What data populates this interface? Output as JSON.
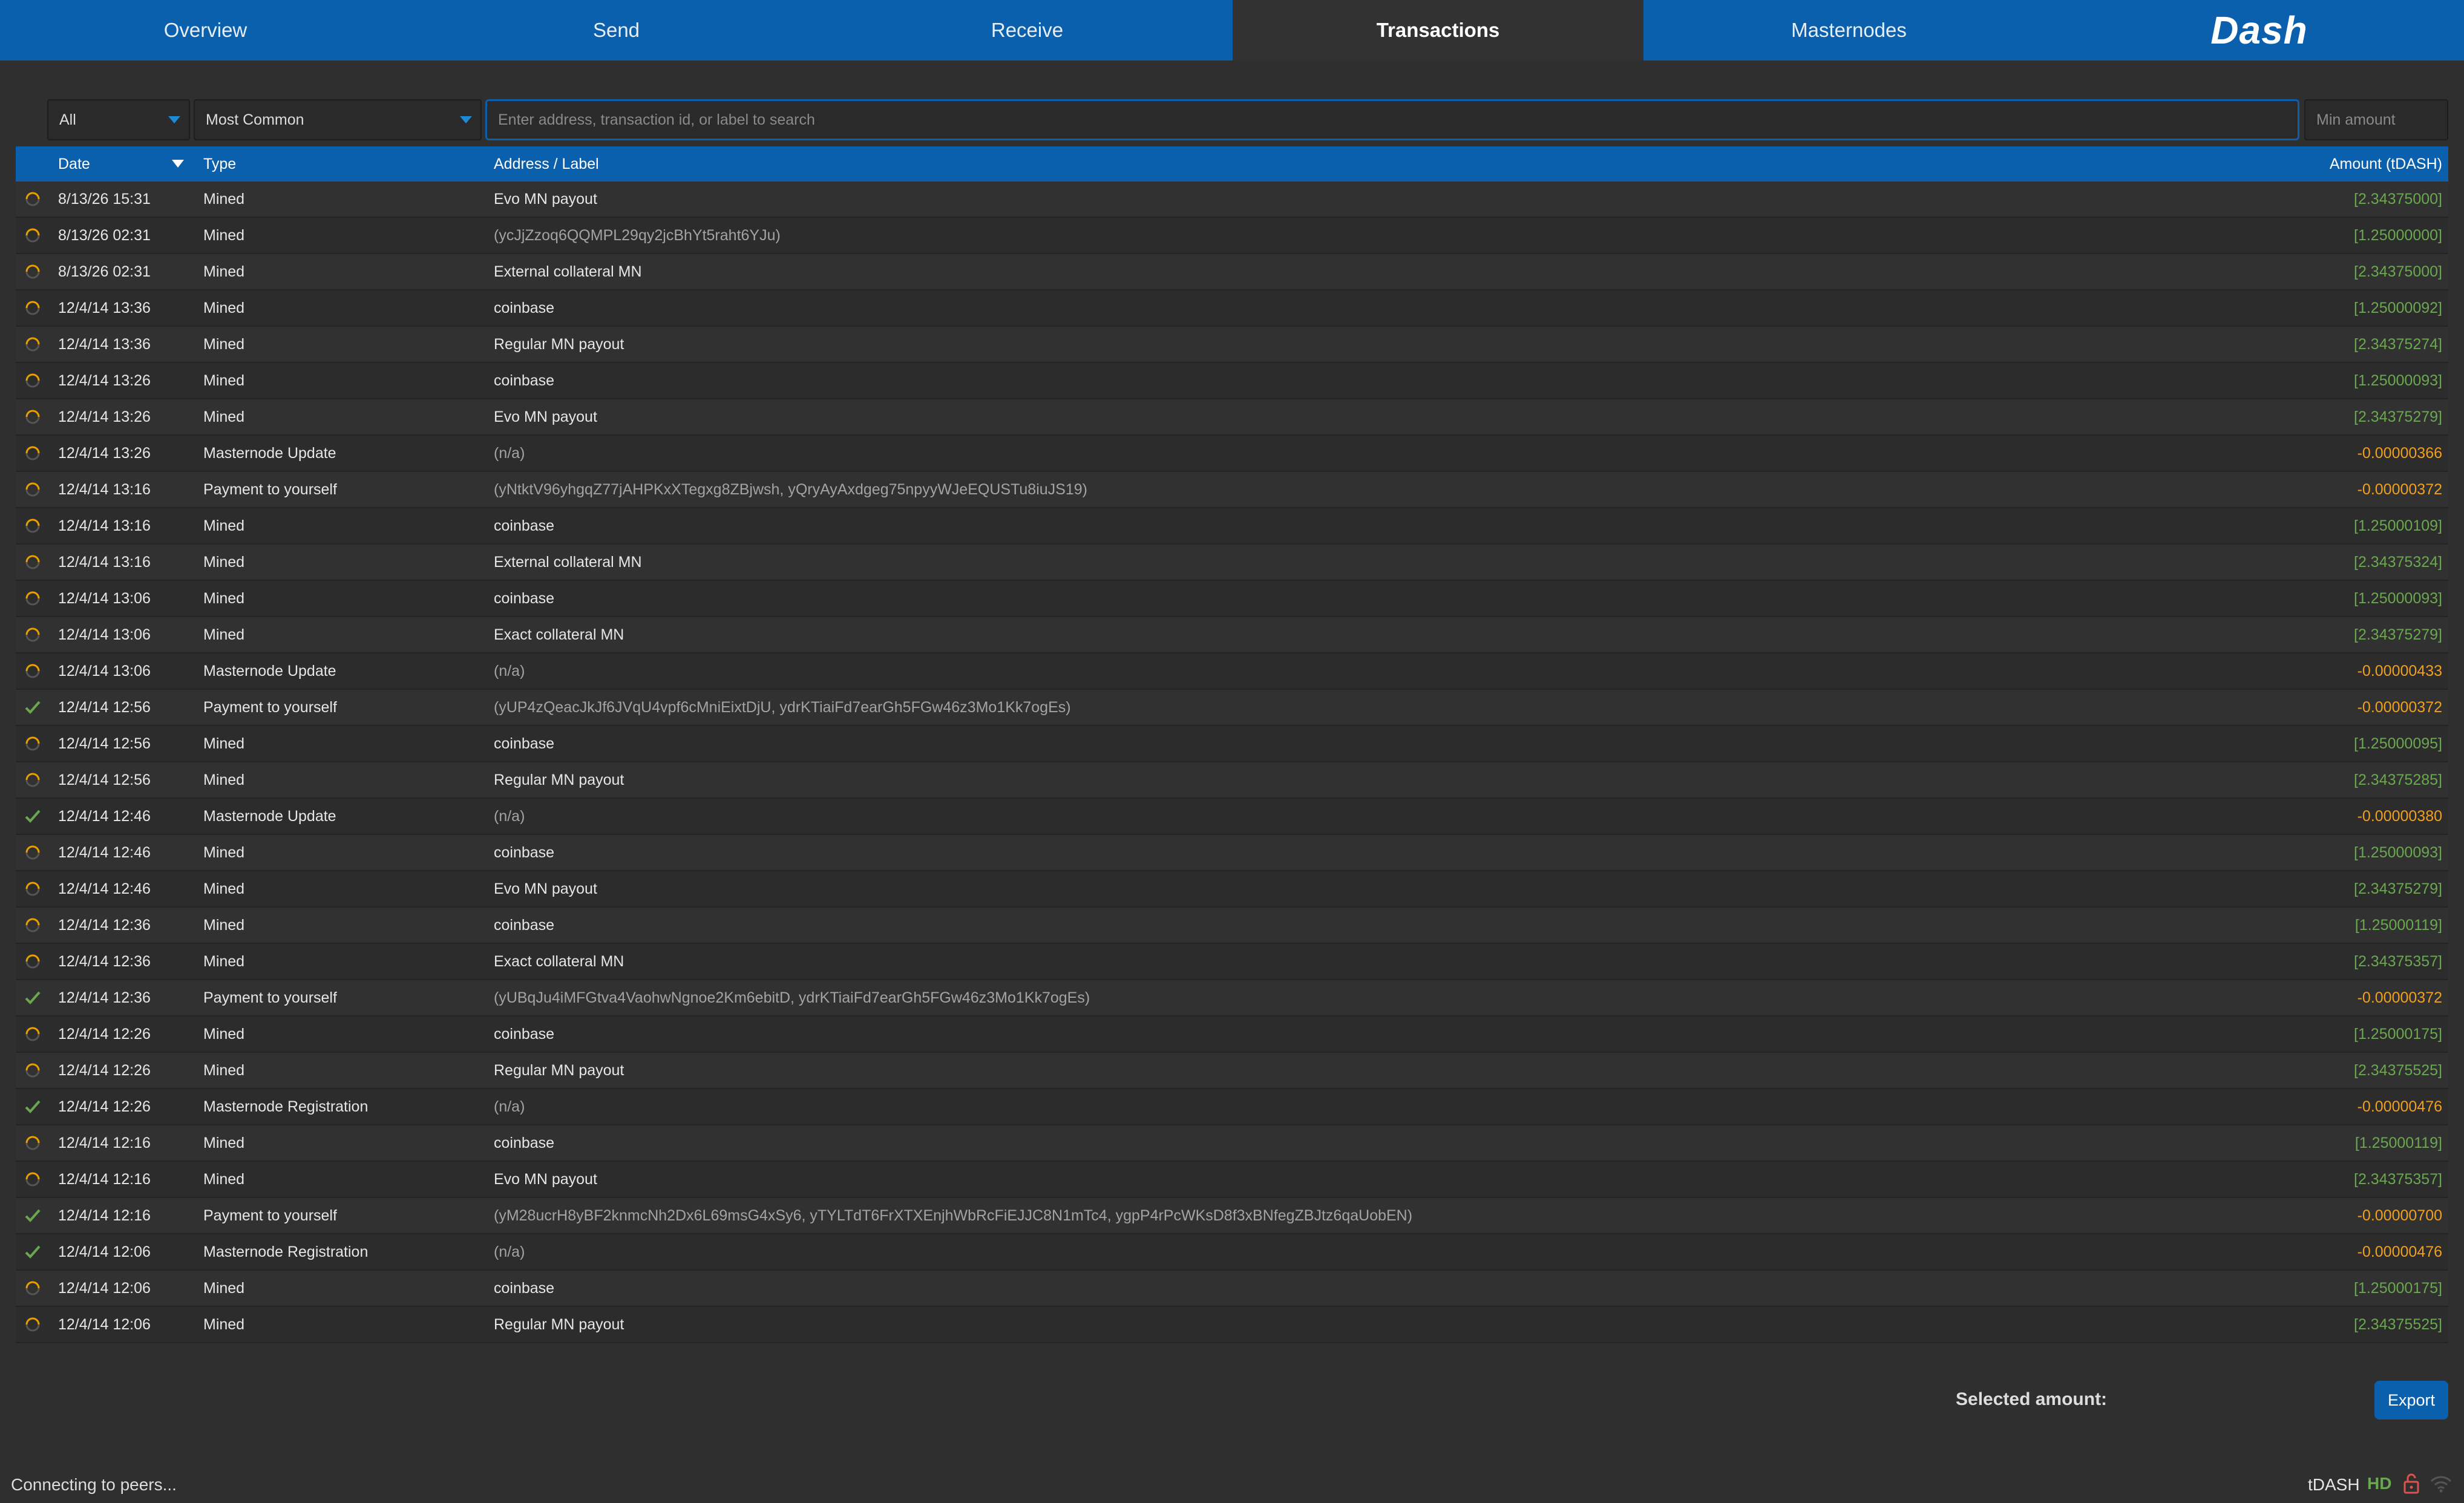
{
  "nav": {
    "tabs": [
      "Overview",
      "Send",
      "Receive",
      "Transactions",
      "Masternodes"
    ],
    "active": "Transactions",
    "logo": "Dash"
  },
  "filters": {
    "type": "All",
    "date_range": "Most Common",
    "search_placeholder": "Enter address, transaction id, or label to search",
    "min_amount_placeholder": "Min amount"
  },
  "table": {
    "headers": {
      "date": "Date",
      "type": "Type",
      "label": "Address / Label",
      "amount": "Amount (tDASH)"
    },
    "rows": [
      {
        "status": "pending",
        "date": "8/13/26 15:31",
        "type": "Mined",
        "label": "Evo MN payout",
        "amount": "[2.34375000]",
        "sign": "pos"
      },
      {
        "status": "pending",
        "date": "8/13/26 02:31",
        "type": "Mined",
        "label": "(ycJjZzoq6QQMPL29qy2jcBhYt5raht6YJu)",
        "amount": "[1.25000000]",
        "sign": "pos"
      },
      {
        "status": "pending",
        "date": "8/13/26 02:31",
        "type": "Mined",
        "label": "External collateral MN",
        "amount": "[2.34375000]",
        "sign": "pos"
      },
      {
        "status": "pending",
        "date": "12/4/14 13:36",
        "type": "Mined",
        "label": "coinbase",
        "amount": "[1.25000092]",
        "sign": "pos"
      },
      {
        "status": "pending",
        "date": "12/4/14 13:36",
        "type": "Mined",
        "label": "Regular MN payout",
        "amount": "[2.34375274]",
        "sign": "pos"
      },
      {
        "status": "pending",
        "date": "12/4/14 13:26",
        "type": "Mined",
        "label": "coinbase",
        "amount": "[1.25000093]",
        "sign": "pos"
      },
      {
        "status": "pending",
        "date": "12/4/14 13:26",
        "type": "Mined",
        "label": "Evo MN payout",
        "amount": "[2.34375279]",
        "sign": "pos"
      },
      {
        "status": "pending",
        "date": "12/4/14 13:26",
        "type": "Masternode Update",
        "label": "(n/a)",
        "amount": "-0.00000366",
        "sign": "neg"
      },
      {
        "status": "pending",
        "date": "12/4/14 13:16",
        "type": "Payment to yourself",
        "label": "(yNtktV96yhgqZ77jAHPKxXTegxg8ZBjwsh, yQryAyAxdgeg75npyyWJeEQUSTu8iuJS19)",
        "amount": "-0.00000372",
        "sign": "neg"
      },
      {
        "status": "pending",
        "date": "12/4/14 13:16",
        "type": "Mined",
        "label": "coinbase",
        "amount": "[1.25000109]",
        "sign": "pos"
      },
      {
        "status": "pending",
        "date": "12/4/14 13:16",
        "type": "Mined",
        "label": "External collateral MN",
        "amount": "[2.34375324]",
        "sign": "pos"
      },
      {
        "status": "pending",
        "date": "12/4/14 13:06",
        "type": "Mined",
        "label": "coinbase",
        "amount": "[1.25000093]",
        "sign": "pos"
      },
      {
        "status": "pending",
        "date": "12/4/14 13:06",
        "type": "Mined",
        "label": "Exact collateral MN",
        "amount": "[2.34375279]",
        "sign": "pos"
      },
      {
        "status": "pending",
        "date": "12/4/14 13:06",
        "type": "Masternode Update",
        "label": "(n/a)",
        "amount": "-0.00000433",
        "sign": "neg"
      },
      {
        "status": "confirmed",
        "date": "12/4/14 12:56",
        "type": "Payment to yourself",
        "label": "(yUP4zQeacJkJf6JVqU4vpf6cMniEixtDjU, ydrKTiaiFd7earGh5FGw46z3Mo1Kk7ogEs)",
        "amount": "-0.00000372",
        "sign": "neg"
      },
      {
        "status": "pending",
        "date": "12/4/14 12:56",
        "type": "Mined",
        "label": "coinbase",
        "amount": "[1.25000095]",
        "sign": "pos"
      },
      {
        "status": "pending",
        "date": "12/4/14 12:56",
        "type": "Mined",
        "label": "Regular MN payout",
        "amount": "[2.34375285]",
        "sign": "pos"
      },
      {
        "status": "confirmed",
        "date": "12/4/14 12:46",
        "type": "Masternode Update",
        "label": "(n/a)",
        "amount": "-0.00000380",
        "sign": "neg"
      },
      {
        "status": "pending",
        "date": "12/4/14 12:46",
        "type": "Mined",
        "label": "coinbase",
        "amount": "[1.25000093]",
        "sign": "pos"
      },
      {
        "status": "pending",
        "date": "12/4/14 12:46",
        "type": "Mined",
        "label": "Evo MN payout",
        "amount": "[2.34375279]",
        "sign": "pos"
      },
      {
        "status": "pending",
        "date": "12/4/14 12:36",
        "type": "Mined",
        "label": "coinbase",
        "amount": "[1.25000119]",
        "sign": "pos"
      },
      {
        "status": "pending",
        "date": "12/4/14 12:36",
        "type": "Mined",
        "label": "Exact collateral MN",
        "amount": "[2.34375357]",
        "sign": "pos"
      },
      {
        "status": "confirmed",
        "date": "12/4/14 12:36",
        "type": "Payment to yourself",
        "label": "(yUBqJu4iMFGtva4VaohwNgnoe2Km6ebitD, ydrKTiaiFd7earGh5FGw46z3Mo1Kk7ogEs)",
        "amount": "-0.00000372",
        "sign": "neg"
      },
      {
        "status": "pending",
        "date": "12/4/14 12:26",
        "type": "Mined",
        "label": "coinbase",
        "amount": "[1.25000175]",
        "sign": "pos"
      },
      {
        "status": "pending",
        "date": "12/4/14 12:26",
        "type": "Mined",
        "label": "Regular MN payout",
        "amount": "[2.34375525]",
        "sign": "pos"
      },
      {
        "status": "confirmed",
        "date": "12/4/14 12:26",
        "type": "Masternode Registration",
        "label": "(n/a)",
        "amount": "-0.00000476",
        "sign": "neg"
      },
      {
        "status": "pending",
        "date": "12/4/14 12:16",
        "type": "Mined",
        "label": "coinbase",
        "amount": "[1.25000119]",
        "sign": "pos"
      },
      {
        "status": "pending",
        "date": "12/4/14 12:16",
        "type": "Mined",
        "label": "Evo MN payout",
        "amount": "[2.34375357]",
        "sign": "pos"
      },
      {
        "status": "confirmed",
        "date": "12/4/14 12:16",
        "type": "Payment to yourself",
        "label": "(yM28ucrH8yBF2knmcNh2Dx6L69msG4xSy6, yTYLTdT6FrXTXEnjhWbRcFiEJJC8N1mTc4, ygpP4rPcWKsD8f3xBNfegZBJtz6qaUobEN)",
        "amount": "-0.00000700",
        "sign": "neg"
      },
      {
        "status": "confirmed",
        "date": "12/4/14 12:06",
        "type": "Masternode Registration",
        "label": "(n/a)",
        "amount": "-0.00000476",
        "sign": "neg"
      },
      {
        "status": "pending",
        "date": "12/4/14 12:06",
        "type": "Mined",
        "label": "coinbase",
        "amount": "[1.25000175]",
        "sign": "pos"
      },
      {
        "status": "pending",
        "date": "12/4/14 12:06",
        "type": "Mined",
        "label": "Regular MN payout",
        "amount": "[2.34375525]",
        "sign": "pos"
      }
    ]
  },
  "footer": {
    "selected_amount_label": "Selected amount:",
    "export_label": "Export",
    "status_text": "Connecting to peers...",
    "unit": "tDASH",
    "hd": "HD"
  },
  "colors": {
    "accent": "#0b60ad",
    "positive": "#6aa84f",
    "negative": "#f0a020",
    "pending_icon": "#e6a100",
    "lock": "#d9534f"
  },
  "icons": {
    "pending": "clock-spinner-icon",
    "confirmed": "checkmark-icon",
    "lock": "lock-icon",
    "network": "wifi-icon"
  }
}
